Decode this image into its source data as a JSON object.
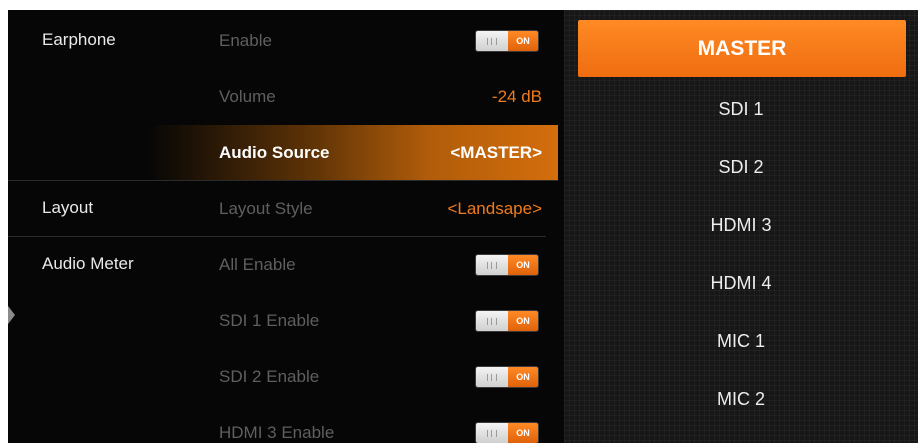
{
  "sections": {
    "earphone": "Earphone",
    "layout": "Layout",
    "audio_meter": "Audio Meter"
  },
  "rows": {
    "enable": {
      "label": "Enable",
      "toggle_on": "ON",
      "state": "on"
    },
    "volume": {
      "label": "Volume",
      "value": "-24 dB"
    },
    "audio_source": {
      "label": "Audio Source",
      "value": "<MASTER>"
    },
    "layout_style": {
      "label": "Layout Style",
      "value": "<Landsape>"
    },
    "all_enable": {
      "label": "All Enable",
      "toggle_on": "ON",
      "state": "on"
    },
    "sdi1_enable": {
      "label": "SDI 1 Enable",
      "toggle_on": "ON",
      "state": "on"
    },
    "sdi2_enable": {
      "label": "SDI 2 Enable",
      "toggle_on": "ON",
      "state": "on"
    },
    "hdmi3_enable": {
      "label": "HDMI 3 Enable",
      "toggle_on": "ON",
      "state": "on"
    }
  },
  "source_list": {
    "selected": "MASTER",
    "items": [
      "MASTER",
      "SDI 1",
      "SDI 2",
      "HDMI 3",
      "HDMI 4",
      "MIC 1",
      "MIC 2"
    ]
  },
  "colors": {
    "accent": "#f07b1c",
    "background": "#060606",
    "dim_text": "#5f5f5f",
    "panel": "#171717"
  },
  "icons": {
    "left_arrow": "triangle-right-icon",
    "toggle_grip": "grip-icon"
  }
}
